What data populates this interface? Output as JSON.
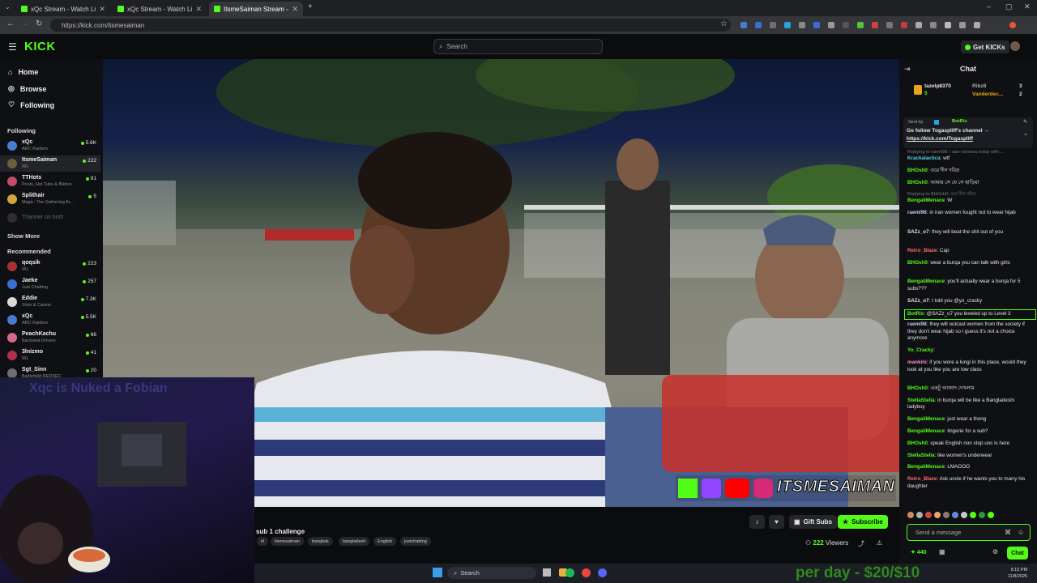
{
  "browser": {
    "tabs": [
      {
        "title": "xQc Stream - Watch Live on Kic",
        "active": false
      },
      {
        "title": "xQc Stream - Watch Live on Kic",
        "active": false
      },
      {
        "title": "ItsmeSaiman Stream - Watc",
        "active": true
      }
    ],
    "url": "https://kick.com/itsmesaiman"
  },
  "header": {
    "logo": "KICK",
    "search_placeholder": "Search",
    "get_kicks": "Get KICKs"
  },
  "sidebar": {
    "nav": [
      {
        "label": "Home",
        "icon": "home-icon"
      },
      {
        "label": "Browse",
        "icon": "compass-icon"
      },
      {
        "label": "Following",
        "icon": "heart-icon"
      }
    ],
    "following_title": "Following",
    "following": [
      {
        "name": "xQc",
        "category": "ARC Raiders",
        "viewers": "5.6K",
        "color": "#4a7bd1",
        "active": false
      },
      {
        "name": "ItsmeSaiman",
        "category": "IRL",
        "viewers": "222",
        "color": "#6b5e3c",
        "active": true
      },
      {
        "name": "TTHots",
        "category": "Pools, Hot Tubs & Bikinis",
        "viewers": "81",
        "color": "#c24a6a",
        "active": false
      },
      {
        "name": "Splithair",
        "category": "Magic: The Gathering Ar...",
        "viewers": "5",
        "color": "#d3a43b",
        "active": false
      }
    ],
    "offline_label": "Thanner on both",
    "show_more": "Show More",
    "recommended_title": "Recommended",
    "recommended": [
      {
        "name": "qoqsik",
        "category": "IRL",
        "viewers": "223",
        "color": "#a83232"
      },
      {
        "name": "Jaeke",
        "category": "Just Chatting",
        "viewers": "257",
        "color": "#3a6fd1"
      },
      {
        "name": "Eddie",
        "category": "Slots & Casino",
        "viewers": "7.3K",
        "color": "#d9d9d9"
      },
      {
        "name": "xQc",
        "category": "ARC Raiders",
        "viewers": "5.5K",
        "color": "#4a7bd1"
      },
      {
        "name": "PeachKachu",
        "category": "Backseat Drivers",
        "viewers": "66",
        "color": "#d46a8a"
      },
      {
        "name": "3lnizmo",
        "category": "IRL",
        "viewers": "41",
        "color": "#b0304a"
      },
      {
        "name": "Sgt_Sinn",
        "category": "Battlefield REDSEC",
        "viewers": "20",
        "color": "#6f6f6f"
      }
    ]
  },
  "webcam": {
    "overlay_text": "Xqc is Nuked a Fobian"
  },
  "video": {
    "socials_handle": "ITSMESAIMAN"
  },
  "stream": {
    "title": "sub 1 challenge",
    "tags": [
      "irl",
      "itsmesaiman",
      "bangkok",
      "bangladesh",
      "English",
      "justchatting"
    ],
    "gift_subs": "Gift Subs",
    "subscribe": "Subscribe",
    "viewer_count": "222",
    "viewers_label": "Viewers"
  },
  "chat": {
    "title": "Chat",
    "gifters": [
      {
        "name": "tazelp8370",
        "count": "5"
      },
      {
        "name": "Ribz8",
        "count": "3"
      },
      {
        "name": "Vanderdec...",
        "count": "2"
      }
    ],
    "pinned": {
      "sent_by_label": "Sent by",
      "sender": "BotRix",
      "text": "Go follow Togaspliff's channel →",
      "link": "https://kick.com/Togaspliff"
    },
    "messages": [
      {
        "reply": "Replying to raemi98: i saw vanessa today with ..."
      },
      {
        "user": "Krackalactica",
        "text": "wtf",
        "color": "#4fd0e8"
      },
      {
        "user": "BHOsh0",
        "text": "ওরে দীন দরিদ্র",
        "color": "#53fc18"
      },
      {
        "user": "BHOsh0",
        "text": "আমার সে যে সে ছাড়িয়া",
        "color": "#53fc18"
      },
      {
        "reply": "Replying to BHOsh0: ওরে দীন দরিদ্র"
      },
      {
        "user": "BengaliMenace",
        "text": "W",
        "color": "#53fc18"
      },
      {
        "user": "raemi98",
        "text": "in iran women fought not to wear hijab",
        "color": "#c8c8ff"
      },
      {
        "user": "SAZz_o7",
        "text": "they will beat the shit out of you",
        "color": "#e0e0e0"
      },
      {
        "user": "Retro_Blaze",
        "text": "Cap",
        "color": "#ff6b6b"
      },
      {
        "user": "BHOsh0",
        "text": "wear a burqa you can talk with girls",
        "color": "#53fc18"
      },
      {
        "user": "BengaliMenace",
        "text": "you'll actually wear a burqa for 5 subs???",
        "color": "#53fc18"
      },
      {
        "user": "SAZz_o7",
        "text": "I told you @yo_cracky",
        "color": "#e0e0e0"
      },
      {
        "user": "BotRix",
        "text": "@SAZz_o7 you leveled up to Level 3",
        "color": "#53fc18",
        "bot": true
      },
      {
        "user": "raemi98",
        "text": "they will outcast women from the society if they don't wear hijab so i guess it's not a choice anymore",
        "color": "#c8c8ff"
      },
      {
        "user": "Yo_Cracky",
        "text": "",
        "color": "#53fc18"
      },
      {
        "user": "mankini",
        "text": "if you wore a lungi in this place, would they look at you like you are low class",
        "color": "#ff8ad8"
      },
      {
        "user": "BHOsh0",
        "text": "একটু আজাদ দেখলাম",
        "color": "#53fc18"
      },
      {
        "user": "StellaStella",
        "text": "in burqa will be like a Bangladeshi ladyboy",
        "color": "#53fc18"
      },
      {
        "user": "BengaliMenace",
        "text": "just wear a thong",
        "color": "#53fc18"
      },
      {
        "user": "BengaliMenace",
        "text": "lingerie for a sub?",
        "color": "#53fc18"
      },
      {
        "user": "BHOsh0",
        "text": "speak English non stop unc is here",
        "color": "#53fc18"
      },
      {
        "user": "StellaStella",
        "text": "like women's underwear",
        "color": "#53fc18"
      },
      {
        "user": "BengaliMenace",
        "text": "LMAOOO",
        "color": "#53fc18"
      },
      {
        "user": "Retro_Blaze",
        "text": "Ask uncle if he wants you to marry his daughter",
        "color": "#ff6b6b"
      }
    ],
    "input_placeholder": "Send a message",
    "points": "440",
    "send_label": "Chat"
  },
  "taskbar": {
    "search": "Search",
    "promo": "per day - $20/$10",
    "time": "8:15 PM",
    "date": "11/8/2025"
  },
  "colors": {
    "accent": "#53fc18",
    "background": "#0b0c0e",
    "panel": "#0f1013"
  }
}
